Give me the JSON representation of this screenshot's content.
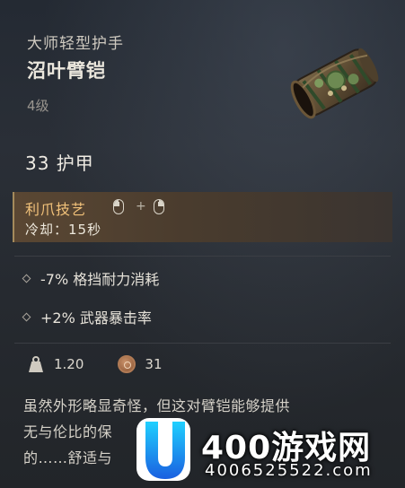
{
  "item": {
    "category": "大师轻型护手",
    "name": "沼叶臂铠",
    "level": "4级",
    "armor": "33 护甲"
  },
  "skill": {
    "title": "利爪技艺",
    "plus": "+",
    "cooldown": "冷却：15秒"
  },
  "stats": [
    {
      "text": "-7% 格挡耐力消耗"
    },
    {
      "text": "+2% 武器暴击率"
    }
  ],
  "meta": {
    "weight": "1.20",
    "price": "31"
  },
  "description": {
    "line1": "虽然外形略显奇怪，但这对臂铠能够提供",
    "line2": "无与伦比的保",
    "line3": "的……舒适与"
  },
  "watermark": {
    "name": "400游戏网",
    "phone": "4006525522.com"
  },
  "colors": {
    "skill_title": "#f2c27a",
    "skill_bg": "#5a4733"
  }
}
